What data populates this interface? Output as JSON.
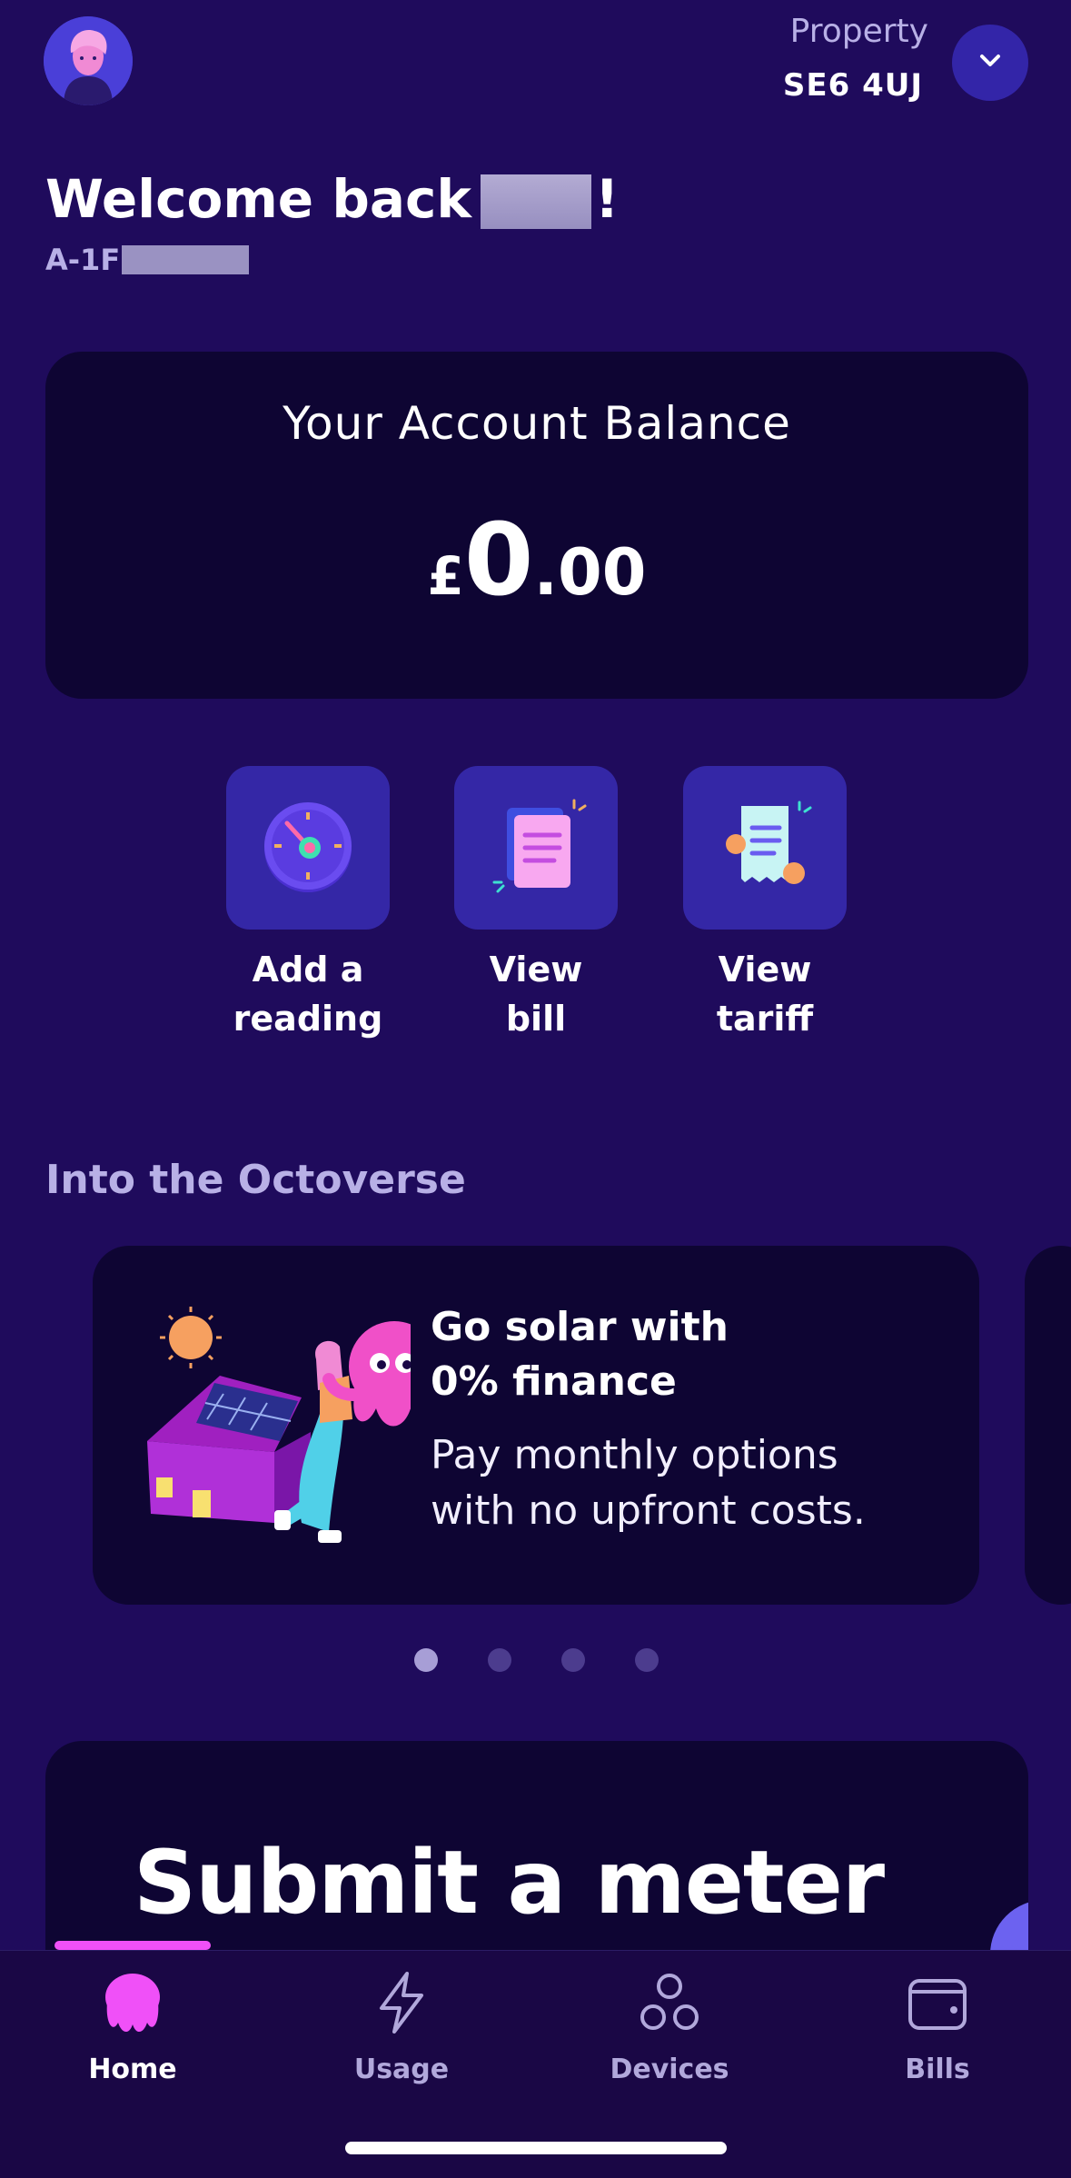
{
  "header": {
    "avatar_icon": "user-avatar-icon",
    "property_label": "Property",
    "property_value": "SE6 4UJ",
    "property_toggle_icon": "chevron-down-icon"
  },
  "welcome": {
    "text": "Welcome back",
    "suffix": "!",
    "account_prefix": "A-1F"
  },
  "balance": {
    "title": "Your Account Balance",
    "currency": "£",
    "whole": "0",
    "decimal": ".00"
  },
  "quick_actions": [
    {
      "line1": "Add a",
      "line2": "reading",
      "icon": "meter-dial-icon"
    },
    {
      "line1": "View",
      "line2": "bill",
      "icon": "bill-document-icon"
    },
    {
      "line1": "View",
      "line2": "tariff",
      "icon": "tariff-receipt-icon"
    }
  ],
  "section": {
    "title": "Into the Octoverse"
  },
  "promo": {
    "title_line1": "Go solar with",
    "title_line2": "0% finance",
    "body_line1": "Pay monthly options",
    "body_line2": "with no upfront costs.",
    "illustration": "solar-house-octopus-illustration"
  },
  "carousel": {
    "pages": 4,
    "active_index": 0
  },
  "meter_card": {
    "title": "Submit a meter"
  },
  "nav": {
    "active": "Home",
    "items": [
      {
        "label": "Home",
        "icon": "octopus-home-icon"
      },
      {
        "label": "Usage",
        "icon": "lightning-icon"
      },
      {
        "label": "Devices",
        "icon": "devices-circles-icon"
      },
      {
        "label": "Bills",
        "icon": "wallet-icon"
      }
    ]
  },
  "colors": {
    "background": "#1f0b5c",
    "card": "#0e0533",
    "tile": "#3427a6",
    "accent_pink": "#f050f8",
    "muted_text": "#b8b0e6"
  }
}
